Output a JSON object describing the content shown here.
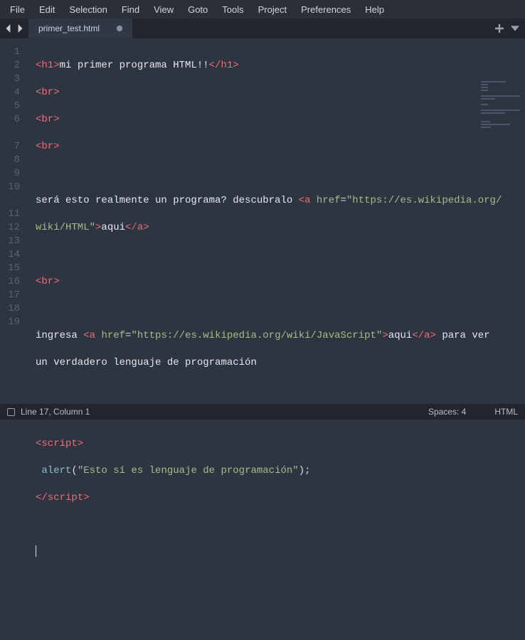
{
  "menu": [
    "File",
    "Edit",
    "Selection",
    "Find",
    "View",
    "Goto",
    "Tools",
    "Project",
    "Preferences",
    "Help"
  ],
  "tab": {
    "filename": "primer_test.html"
  },
  "gutter_lines": [
    "1",
    "2",
    "3",
    "4",
    "5",
    "6",
    "7",
    "8",
    "9",
    "10",
    "11",
    "12",
    "13",
    "14",
    "15",
    "16",
    "17",
    "18",
    "19"
  ],
  "code": {
    "l1_a": "<h1>",
    "l1_b": "mi primer programa HTML!!",
    "l1_c": "</h1>",
    "l2": "<br>",
    "l3": "<br>",
    "l4": "<br>",
    "l6_a": "será esto realmente un programa? descubralo ",
    "l6_b": "<a ",
    "l6_c": "href",
    "l6_d": "=",
    "l6_e": "\"https://es.wikipedia.org/",
    "l6_f": "wiki/HTML\"",
    "l6_g": ">",
    "l6_h": "aqui",
    "l6_i": "</a>",
    "l8": "<br>",
    "l10_a": "ingresa ",
    "l10_b": "<a ",
    "l10_c": "href",
    "l10_d": "=",
    "l10_e": "\"https://es.wikipedia.org/wiki/JavaScript\"",
    "l10_f": ">",
    "l10_g": "aqui",
    "l10_h": "</a>",
    "l10_i": " para ver",
    "l10_j": "un verdadero lenguaje de programación",
    "l13": "<script>",
    "l14_a": " ",
    "l14_b": "alert",
    "l14_c": "(",
    "l14_d": "\"Esto sí es lenguaje de programación\"",
    "l14_e": ");",
    "l15": "</",
    "l15b": "script",
    "l15c": ">"
  },
  "status": {
    "position": "Line 17, Column 1",
    "spaces": "Spaces: 4",
    "lang": "HTML"
  }
}
